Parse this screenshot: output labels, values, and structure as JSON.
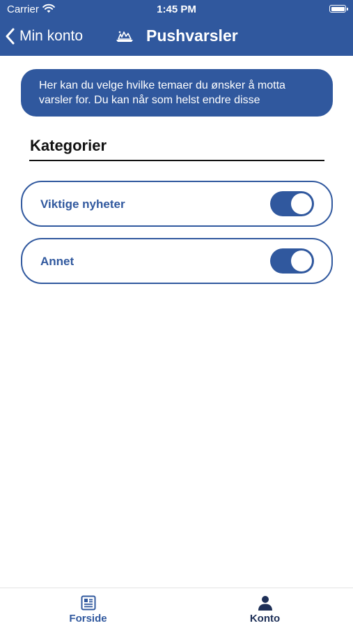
{
  "status_bar": {
    "carrier": "Carrier",
    "time": "1:45 PM"
  },
  "nav": {
    "back_label": "Min konto",
    "title": "Pushvarsler"
  },
  "info_banner": {
    "text": "Her kan du velge hvilke temaer du ønsker å motta varsler for. Du kan når som helst endre disse"
  },
  "section": {
    "title": "Kategorier"
  },
  "categories": [
    {
      "label": "Viktige nyheter",
      "enabled": true
    },
    {
      "label": "Annet",
      "enabled": true
    }
  ],
  "tabs": [
    {
      "label": "Forside",
      "icon": "newspaper-icon",
      "active": false
    },
    {
      "label": "Konto",
      "icon": "person-icon",
      "active": true
    }
  ],
  "colors": {
    "brand": "#30589e",
    "tab_inactive": "#30589e",
    "tab_active": "#1d2f57",
    "text_dark": "#111111",
    "background": "#ffffff"
  }
}
